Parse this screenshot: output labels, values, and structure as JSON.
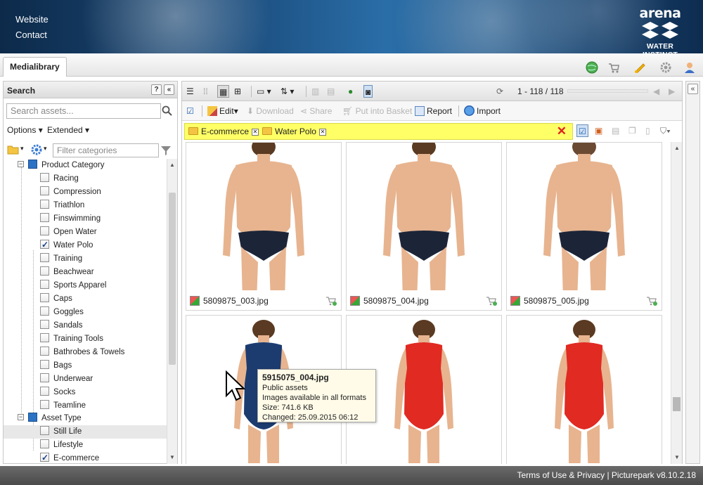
{
  "header": {
    "links": [
      "Website",
      "Contact"
    ],
    "logo_brand": "arena",
    "logo_tagline": "WATER INSTINCT"
  },
  "tabs": {
    "active": "Medialibrary"
  },
  "top_icons": [
    "globe-icon",
    "basket-icon",
    "bell-icon",
    "gear-icon",
    "user-icon"
  ],
  "search": {
    "title": "Search",
    "placeholder": "Search assets...",
    "options_label": "Options",
    "extended_label": "Extended",
    "filter_placeholder": "Filter categories"
  },
  "tree": {
    "product_category": {
      "label": "Product Category",
      "items": [
        {
          "label": "Racing",
          "checked": false
        },
        {
          "label": "Compression",
          "checked": false
        },
        {
          "label": "Triathlon",
          "checked": false
        },
        {
          "label": "Finswimming",
          "checked": false
        },
        {
          "label": "Open Water",
          "checked": false
        },
        {
          "label": "Water Polo",
          "checked": true
        },
        {
          "label": "Training",
          "checked": false
        },
        {
          "label": "Beachwear",
          "checked": false
        },
        {
          "label": "Sports Apparel",
          "checked": false
        },
        {
          "label": "Caps",
          "checked": false
        },
        {
          "label": "Goggles",
          "checked": false
        },
        {
          "label": "Sandals",
          "checked": false
        },
        {
          "label": "Training Tools",
          "checked": false
        },
        {
          "label": "Bathrobes & Towels",
          "checked": false
        },
        {
          "label": "Bags",
          "checked": false
        },
        {
          "label": "Underwear",
          "checked": false
        },
        {
          "label": "Socks",
          "checked": false
        },
        {
          "label": "Teamline",
          "checked": false
        }
      ]
    },
    "asset_type": {
      "label": "Asset Type",
      "items": [
        {
          "label": "Still Life",
          "checked": false
        },
        {
          "label": "Lifestyle",
          "checked": false
        },
        {
          "label": "E-commerce",
          "checked": true
        }
      ]
    }
  },
  "toolbar": {
    "pagination": "1 - 118 / 118",
    "edit": "Edit",
    "download": "Download",
    "share": "Share",
    "put_into_basket": "Put into Basket",
    "report": "Report",
    "import": "Import"
  },
  "filters": [
    "E-commerce",
    "Water Polo"
  ],
  "assets": [
    {
      "name": "5809875_003.jpg",
      "swimwear": "#1c2438",
      "view": "back"
    },
    {
      "name": "5809875_004.jpg",
      "swimwear": "#1c2438",
      "view": "back"
    },
    {
      "name": "5809875_005.jpg",
      "swimwear": "#1c2438",
      "view": "front"
    },
    {
      "name": "",
      "swimwear": "#1c3c70",
      "view": "side"
    },
    {
      "name": "",
      "swimwear": "#e02a22",
      "view": "front"
    },
    {
      "name": "",
      "swimwear": "#e02a22",
      "view": "side"
    }
  ],
  "tooltip": {
    "title": "5915075_004.jpg",
    "line1": "Public assets",
    "line2": "Images available in all formats",
    "line3": "Size: 741.6 KB",
    "line4": "Changed: 25.09.2015 06:12"
  },
  "footer": {
    "text": "Terms of Use & Privacy | Picturepark v8.10.2.18"
  }
}
